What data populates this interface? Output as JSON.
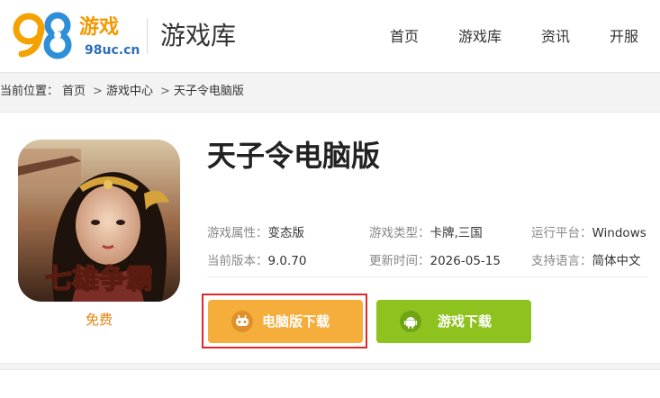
{
  "header": {
    "logo": {
      "digits_blue": "9",
      "digits_orange": "8",
      "text": "游戏",
      "domain": "98uc.cn"
    },
    "section_title": "游戏库",
    "nav": [
      "首页",
      "游戏库",
      "资讯",
      "开服"
    ]
  },
  "breadcrumb": {
    "prefix": "当前位置：",
    "items": [
      "首页",
      "游戏中心",
      "天子令电脑版"
    ],
    "separator": ">"
  },
  "game": {
    "title": "天子令电脑版",
    "icon_art_text": "七雄争霸",
    "price": "免费",
    "info": {
      "attribute_label": "游戏属性：",
      "attribute": "变态版",
      "type_label": "游戏类型：",
      "type": "卡牌,三国",
      "platform_label": "运行平台：",
      "platform": "Windows",
      "version_label": "当前版本：",
      "version": "9.0.70",
      "updated_label": "更新时间：",
      "updated": "2026-05-15",
      "language_label": "支持语言：",
      "language": "简体中文"
    },
    "buttons": {
      "pc_download": "电脑版下载",
      "game_download": "游戏下载"
    }
  },
  "colors": {
    "accent_orange": "#f5ae3b",
    "accent_green": "#8dc21f",
    "highlight_red": "#e0272c",
    "price_orange": "#e8820c"
  }
}
